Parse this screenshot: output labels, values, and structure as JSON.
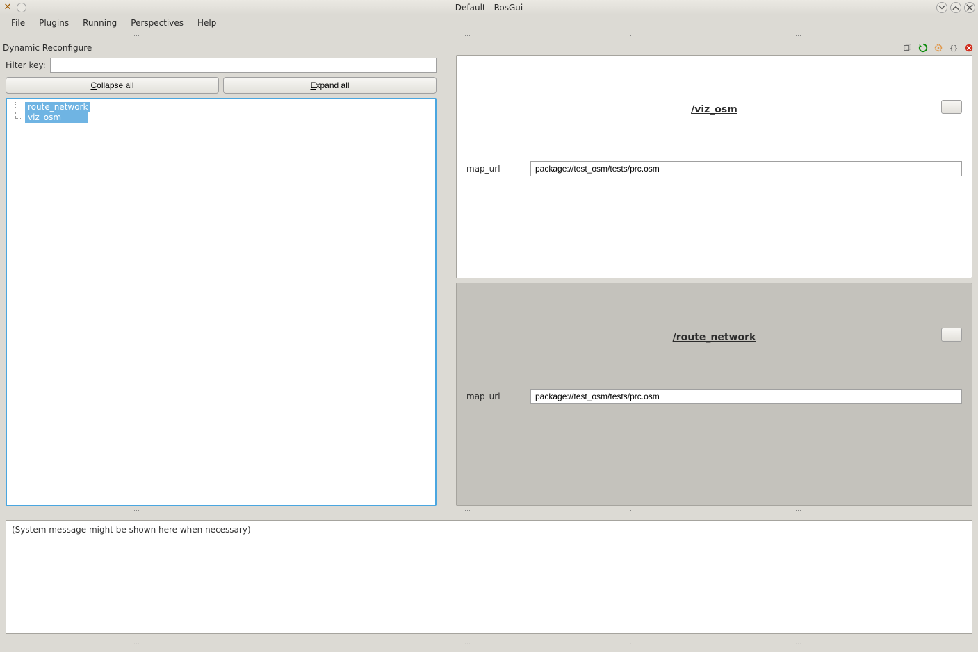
{
  "window": {
    "title": "Default - RosGui"
  },
  "menu": [
    "File",
    "Plugins",
    "Running",
    "Perspectives",
    "Help"
  ],
  "plugin": {
    "title": "Dynamic Reconfigure",
    "filter_label_pre": "F",
    "filter_label_ul": "ilter key:",
    "filter_value": "",
    "collapse_pre": "",
    "collapse_ul": "C",
    "collapse_post": "ollapse all",
    "expand_pre": "",
    "expand_ul": "E",
    "expand_post": "xpand all",
    "tree": [
      {
        "name": "route_network"
      },
      {
        "name": "viz_osm"
      }
    ]
  },
  "nodes": [
    {
      "title": "/viz_osm",
      "params": [
        {
          "label": "map_url",
          "value": "package://test_osm/tests/prc.osm"
        }
      ]
    },
    {
      "title": "/route_network",
      "params": [
        {
          "label": "map_url",
          "value": "package://test_osm/tests/prc.osm"
        }
      ]
    }
  ],
  "sysmsg": "(System message might be shown here when necessary)"
}
